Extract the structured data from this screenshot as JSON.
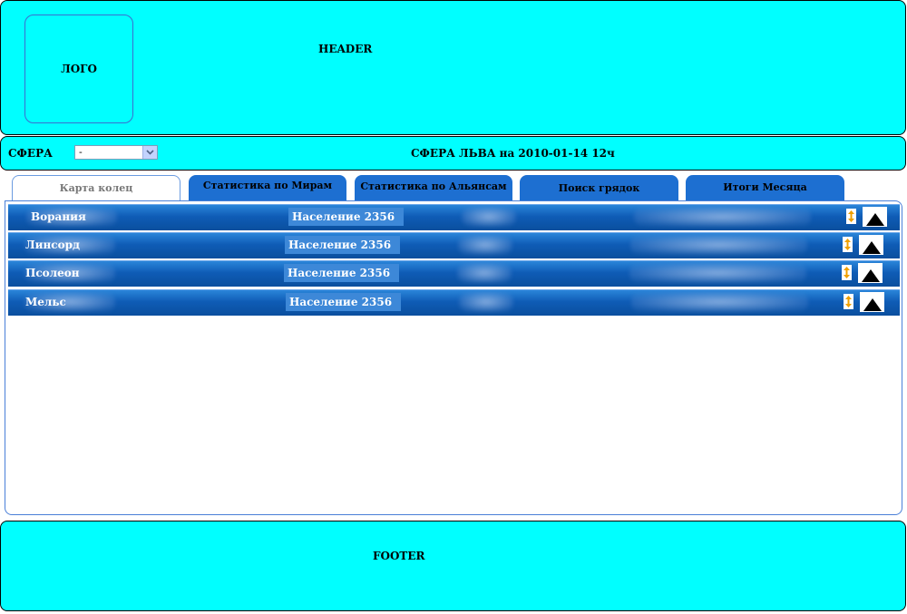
{
  "header": {
    "logo_text": "ЛОГО",
    "title": "HEADER"
  },
  "subbar": {
    "label": "СФЕРА",
    "select_value": "-",
    "title": "СФЕРА ЛЬВА  на 2010-01-14 12ч"
  },
  "tabs": [
    {
      "label": "Карта колец",
      "active": true
    },
    {
      "label": "Статистика по Мирам",
      "active": false
    },
    {
      "label": "Статистика по Альянсам",
      "active": false
    },
    {
      "label": "Поиск грядок",
      "active": false
    },
    {
      "label": "Итоги Месяца",
      "active": false
    }
  ],
  "rows": [
    {
      "name": "Ворания",
      "population": "Население 2356"
    },
    {
      "name": "Линсорд",
      "population": "Население 2356"
    },
    {
      "name": "Псолеон",
      "population": "Население 2356"
    },
    {
      "name": "Мельс",
      "population": "Население 2356"
    }
  ],
  "footer": {
    "title": "FOOTER"
  },
  "colors": {
    "header_bg": "#00ffff",
    "tab_blue": "#1d6fd1",
    "row_blue": "#0f5cb6"
  },
  "icons": {
    "sort": "sort-updown-icon",
    "up": "triangle-up-icon",
    "dropdown": "chevron-down-icon"
  }
}
